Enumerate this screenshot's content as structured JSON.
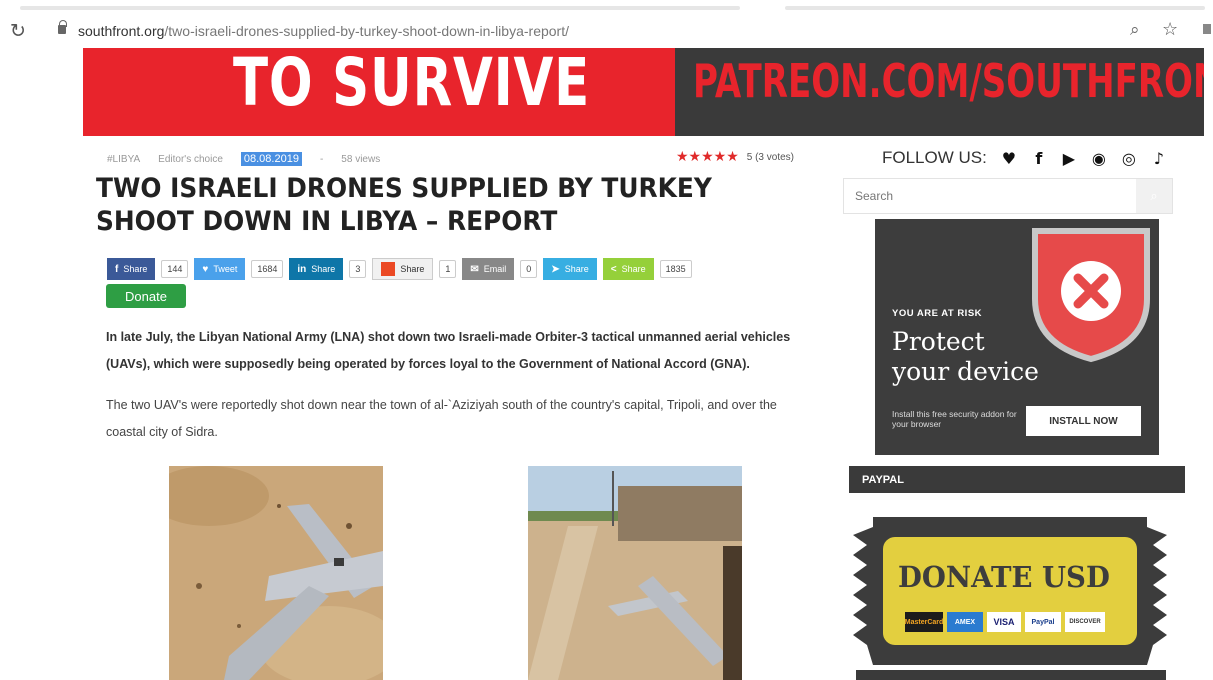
{
  "browser": {
    "url_domain": "southfront.org",
    "url_path": "/two-israeli-drones-supplied-by-turkey-shoot-down-in-libya-report/",
    "reload_icon": "reload-icon",
    "zoom_icon": "zoom-icon",
    "bookmark_icon": "star-icon"
  },
  "banner": {
    "left_text": "TO SURVIVE",
    "right_text": "PATREON.COM/SOUTHFRONT"
  },
  "article": {
    "tag": "#LIBYA",
    "category": "Editor's choice",
    "date": "08.08.2019",
    "separator": "-",
    "views": "58 views",
    "stars": "★★★★★",
    "rating": "5 (3 votes)",
    "title": "TWO ISRAELI DRONES SUPPLIED BY TURKEY SHOOT DOWN IN LIBYA – REPORT",
    "paragraph1": "In late July, the Libyan National Army (LNA) shot down two Israeli-made Orbiter-3 tactical unmanned aerial vehicles (UAVs), which were supposedly being operated by forces loyal to the Government of National Accord (GNA).",
    "paragraph2": "The two UAV's were reportedly shot down near the town of al-`Aziziyah south of the country's capital, Tripoli, and over the coastal city of Sidra."
  },
  "share": {
    "facebook": {
      "label": "Share",
      "count": "144"
    },
    "twitter": {
      "label": "Tweet",
      "count": "1684"
    },
    "linkedin": {
      "label": "Share",
      "count": "3"
    },
    "stumble": {
      "label": "Share",
      "count": "1"
    },
    "email": {
      "label": "Email",
      "count": "0"
    },
    "telegram": {
      "label": "Share"
    },
    "sharethis": {
      "label": "Share",
      "count": "1835"
    },
    "donate": "Donate"
  },
  "sidebar": {
    "follow_label": "FOLLOW US:",
    "social": [
      "twitter-icon",
      "facebook-icon",
      "youtube-icon",
      "telegram-icon",
      "instagram-icon",
      "tiktok-icon"
    ],
    "search_placeholder": "Search",
    "ad": {
      "risk": "YOU ARE AT RISK",
      "headline1": "Protect",
      "headline2": "your device",
      "small": "Install this free security addon for your browser",
      "button": "INSTALL NOW"
    },
    "paypal_header": "PAYPAL",
    "donate_ticket": "DONATE USD",
    "cards": [
      "MasterCard",
      "AMEX",
      "VISA",
      "PayPal",
      "DISCOVER"
    ]
  },
  "colors": {
    "banner_red": "#e8242c",
    "banner_dark": "#3a3a3a",
    "donate_green": "#2e9e44",
    "ticket_yellow": "#e3cf3f"
  }
}
